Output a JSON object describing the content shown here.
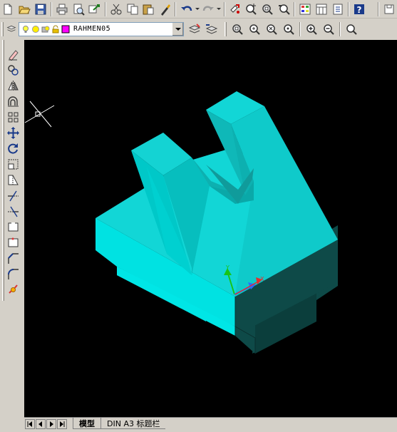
{
  "layer_toolbar": {
    "current_layer": "RAHMEN05",
    "layer_color": "#ff00ff"
  },
  "standard_toolbar": {
    "icons": [
      "new-icon",
      "open-icon",
      "save-icon",
      "print-icon",
      "print-preview-icon",
      "publish-icon",
      "cut-icon",
      "copy-icon",
      "paste-icon",
      "match-properties-icon",
      "undo-icon",
      "redo-icon",
      "pan-realtime-icon",
      "zoom-realtime-icon",
      "zoom-window-icon",
      "zoom-previous-icon",
      "properties-icon",
      "design-center-icon",
      "tool-palettes-icon",
      "help-icon"
    ]
  },
  "modify_toolbar": {
    "icons": [
      "erase-icon",
      "copy-object-icon",
      "mirror-icon",
      "offset-icon",
      "array-icon",
      "move-icon",
      "rotate-icon",
      "scale-icon",
      "stretch-icon",
      "trim-icon",
      "extend-icon",
      "break-icon",
      "break-at-point-icon",
      "chamfer-icon",
      "fillet-icon",
      "explode-icon"
    ]
  },
  "viewport": {
    "background": "#000000",
    "model_top_color": "#12d6d6",
    "model_left_color": "#00e5e5",
    "model_right_color": "#0fb8b8",
    "model_dark_color": "#0e4a48",
    "ucs_icon": "ucs-axis-icon"
  },
  "layout_tabs": {
    "model_tab": "模型",
    "layout_tab": "DIN A3 标题栏"
  }
}
